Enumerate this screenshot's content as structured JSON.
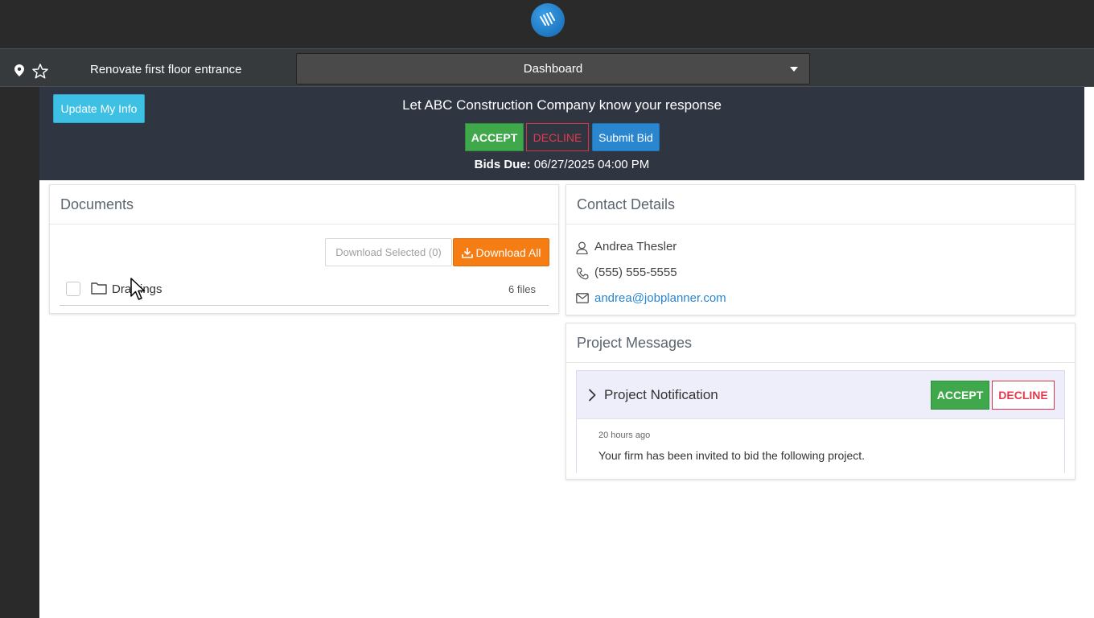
{
  "header": {
    "logo_icon": "jobplanner-logo-icon"
  },
  "subbar": {
    "project_name": "Renovate first floor entrance",
    "view_select": "Dashboard"
  },
  "response": {
    "update_button": "Update My Info",
    "title": "Let ABC Construction Company know your response",
    "accept_label": "ACCEPT",
    "decline_label": "DECLINE",
    "submit_bid_label": "Submit Bid",
    "bids_due_label": "Bids Due:",
    "bids_due_value": "06/27/2025 04:00 PM"
  },
  "documents": {
    "title": "Documents",
    "download_selected": "Download Selected (0)",
    "download_all": "Download All",
    "items": [
      {
        "name": "Drawings",
        "count": "6 files"
      }
    ]
  },
  "contact": {
    "title": "Contact Details",
    "name": "Andrea Thesler",
    "phone": "(555) 555-5555",
    "email": "andrea@jobplanner.com"
  },
  "messages": {
    "title": "Project Messages",
    "items": [
      {
        "title": "Project Notification",
        "accept_label": "ACCEPT",
        "decline_label": "DECLINE",
        "time": "20 hours ago",
        "body": "Your firm has been invited to bid the following project."
      }
    ]
  },
  "colors": {
    "accept": "#3fa84b",
    "decline": "#e33a4d",
    "primary": "#2a86cf",
    "info": "#3cc0e4",
    "download": "#f57d14"
  }
}
